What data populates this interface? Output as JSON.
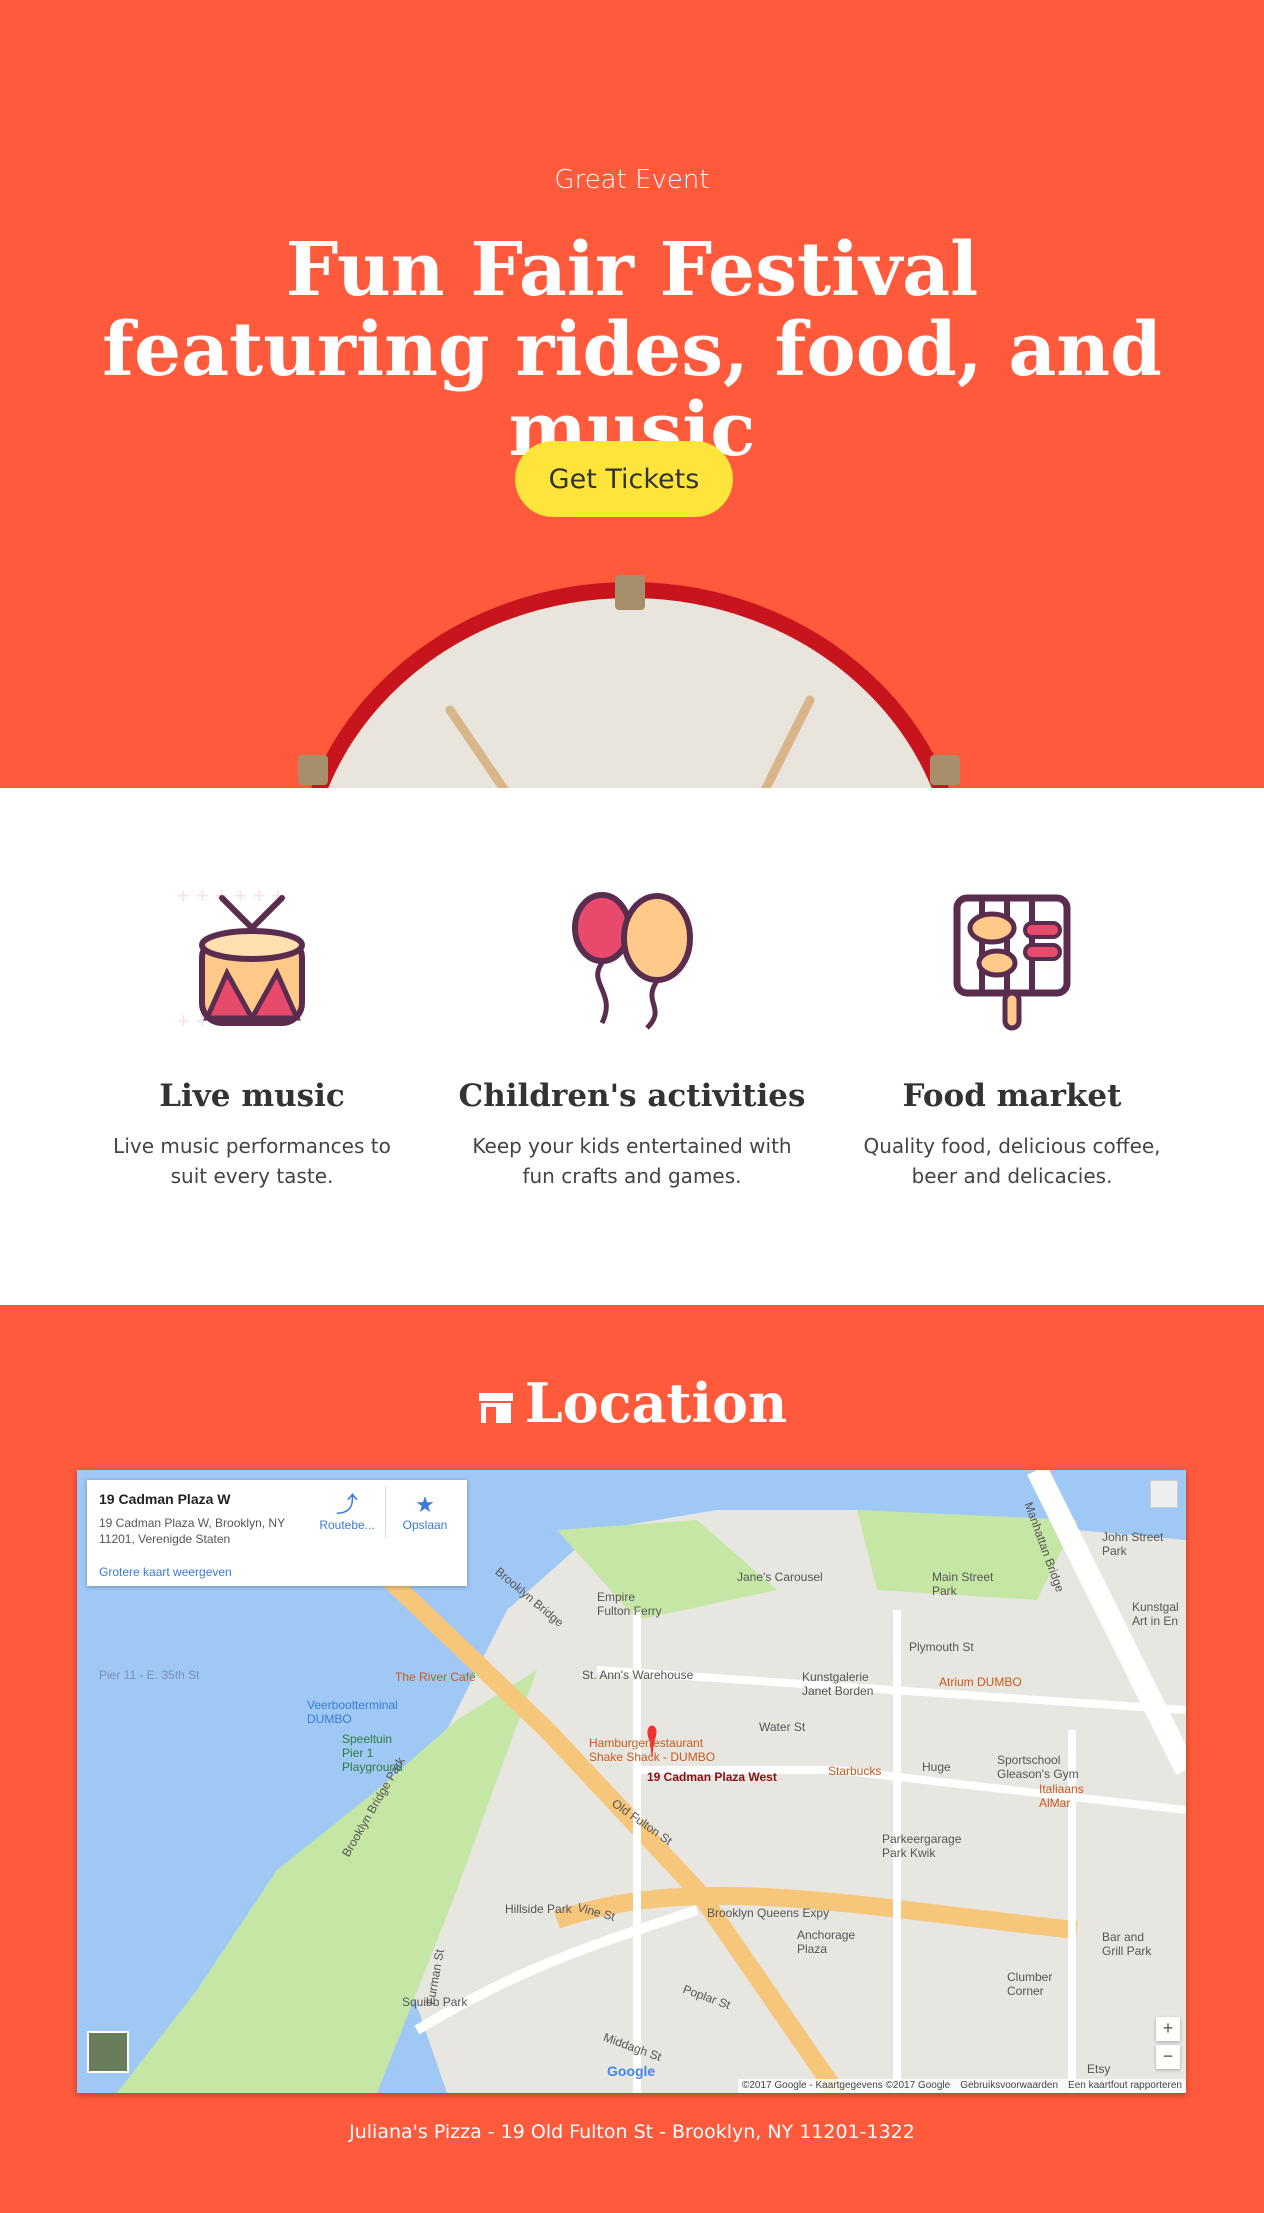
{
  "hero": {
    "eyebrow": "Great Event",
    "title": "Fun Fair Festival featuring rides, food, and music",
    "cta_label": "Get Tickets"
  },
  "features": [
    {
      "icon": "drum-icon",
      "title": "Live music",
      "text": "Live music performances to suit every taste."
    },
    {
      "icon": "balloons-icon",
      "title": "Children's activities",
      "text": "Keep your kids entertained with fun crafts and games."
    },
    {
      "icon": "grill-icon",
      "title": "Food market",
      "text": "Quality food, delicious coffee, beer and delicacies."
    }
  ],
  "location": {
    "heading": "Location",
    "address": "Juliana's Pizza - 19 Old Fulton St - Brooklyn, NY 11201-1322"
  },
  "map": {
    "card_title": "19 Cadman Plaza W",
    "card_address": "19 Cadman Plaza W, Brooklyn, NY 11201, Verenigde Staten",
    "card_link": "Grotere kaart weergeven",
    "route_label": "Routebe...",
    "save_label": "Opslaan",
    "pin_label": "19 Cadman Plaza West",
    "zoom_in": "+",
    "zoom_out": "−",
    "attribution": "©2017 Google - Kaartgegevens ©2017 Google",
    "terms": "Gebruiksvoorwaarden",
    "report": "Een kaartfout rapporteren",
    "google": "Google",
    "labels": {
      "janes": "Jane's Carousel",
      "empire": "Empire Fulton Ferry",
      "brooklyn_bridge": "Brooklyn Bridge",
      "manhattan_bridge": "Manhattan Bridge",
      "john_street": "John Street Park",
      "main_street": "Main Street Park",
      "plymouth": "Plymouth St",
      "st_anns": "St. Ann's Warehouse",
      "river_cafe": "The River Café",
      "pier": "Pier 11 - E. 35th St",
      "veer": "Veerbootterminal DUMBO",
      "speeltuin": "Speeltuin Pier 1 Playground",
      "kunstgalerie": "Kunstgalerie Janet Borden",
      "atrium": "Atrium DUMBO",
      "water_st": "Water St",
      "hamburger": "Hamburgerrestaurant Shake Shack - DUMBO",
      "starbucks": "Starbucks",
      "huge": "Huge",
      "sportschool": "Sportschool Gleason's Gym",
      "italiaans": "Italiaans AlMar",
      "parkeer": "Parkeergarage Park Kwik",
      "old_fulton": "Old Fulton St",
      "furman": "Furman St",
      "hillside": "Hillside Park",
      "vine": "Vine St",
      "bqe": "Brooklyn Queens Expy",
      "anchorage": "Anchorage Plaza",
      "clumber": "Clumber Corner",
      "bar": "Bar and Grill Park",
      "squibb": "Squibb Park",
      "poplar": "Poplar St",
      "middagh": "Middagh St",
      "brooklyn_heights": "Brooklyn Bridge Park",
      "etsy": "Etsy",
      "kunst2": "Kunstgal Art in En"
    }
  }
}
